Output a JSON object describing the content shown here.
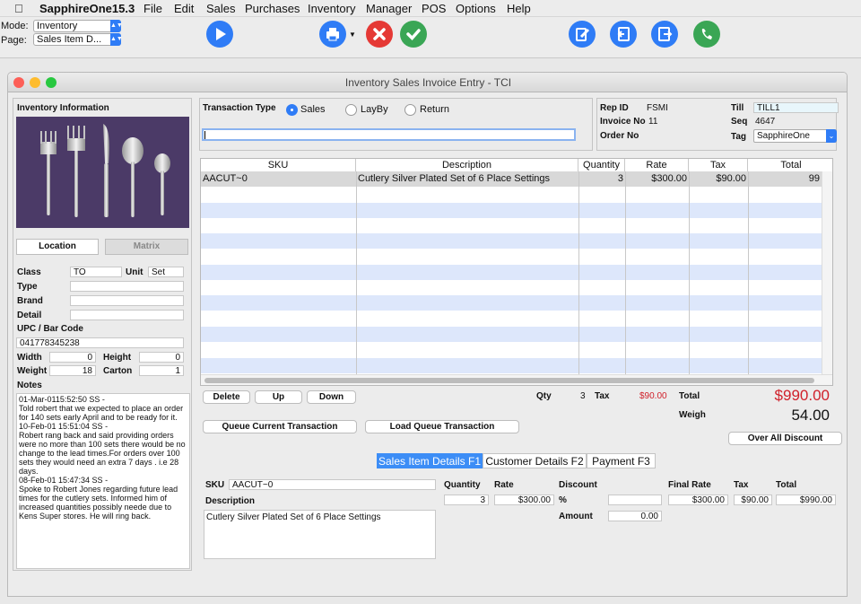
{
  "menubar": {
    "app_name": "SapphireOne15.3",
    "items": [
      "File",
      "Edit",
      "Sales",
      "Purchases",
      "Inventory",
      "Manager",
      "POS",
      "Options",
      "Help"
    ]
  },
  "toolbar": {
    "mode_label": "Mode:",
    "mode_value": "Inventory",
    "page_label": "Page:",
    "page_value": "Sales Item D..."
  },
  "window": {
    "title": "Inventory Sales Invoice Entry - TCI"
  },
  "inventory": {
    "heading": "Inventory Information",
    "tab_location": "Location",
    "tab_matrix": "Matrix",
    "class_label": "Class",
    "class_value": "TO",
    "unit_label": "Unit",
    "unit_value": "Set",
    "type_label": "Type",
    "brand_label": "Brand",
    "detail_label": "Detail",
    "upc_label": "UPC / Bar Code",
    "upc_value": "041778345238",
    "width_label": "Width",
    "width_value": "0",
    "height_label": "Height",
    "height_value": "0",
    "weight_label": "Weight",
    "weight_value": "18",
    "carton_label": "Carton",
    "carton_value": "1",
    "notes_label": "Notes",
    "notes_text": "01-Mar-0115:52:50 SS -\nTold robert that we expected to place an order for 140 sets early April and to be ready for it.\n10-Feb-01 15:51:04 SS -\nRobert rang back and said providing orders were no more than 100 sets there would be no change to the lead times.For orders over 100 sets they would need an extra 7 days . i.e 28 days.\n08-Feb-01 15:47:34 SS -\nSpoke to Robert Jones regarding future lead times for the cutlery sets. Informed him of increased quantities possibly neede due to Kens Super stores. He will ring back."
  },
  "transaction": {
    "label": "Transaction Type",
    "options": [
      "Sales",
      "LayBy",
      "Return"
    ],
    "selected": "Sales"
  },
  "header_info": {
    "rep_label": "Rep ID",
    "rep_value": "FSMI",
    "invoice_label": "Invoice No",
    "invoice_value": "11",
    "order_label": "Order No",
    "till_label": "Till",
    "till_value": "TILL1",
    "seq_label": "Seq",
    "seq_value": "4647",
    "tag_label": "Tag",
    "tag_value": "SapphireOne"
  },
  "grid": {
    "columns": [
      "SKU",
      "Description",
      "Quantity",
      "Rate",
      "Tax",
      "Total"
    ],
    "rows": [
      {
        "sku": "AACUT~0",
        "description": "Cutlery Silver Plated Set of 6 Place Settings",
        "quantity": "3",
        "rate": "$300.00",
        "tax": "$90.00",
        "total": "99"
      }
    ]
  },
  "actions": {
    "delete": "Delete",
    "up": "Up",
    "down": "Down",
    "queue_current": "Queue Current Transaction",
    "load_queue": "Load Queue Transaction",
    "over_all_discount": "Over All Discount"
  },
  "totals": {
    "qty_label": "Qty",
    "qty_value": "3",
    "tax_label": "Tax",
    "tax_value": "$90.00",
    "total_label": "Total",
    "total_value": "$990.00",
    "weigh_label": "Weigh",
    "weigh_value": "54.00"
  },
  "tabs": [
    "Sales Item Details F1",
    "Customer Details F2",
    "Payment F3"
  ],
  "details": {
    "sku_label": "SKU",
    "sku_value": "AACUT~0",
    "description_label": "Description",
    "description_value": "Cutlery Silver Plated Set of 6 Place Settings",
    "quantity_label": "Quantity",
    "quantity_value": "3",
    "rate_label": "Rate",
    "rate_value": "$300.00",
    "discount_label": "Discount",
    "percent_label": "%",
    "amount_label": "Amount",
    "amount_value": "0.00",
    "final_rate_label": "Final Rate",
    "final_rate_value": "$300.00",
    "tax_label": "Tax",
    "tax_value": "$90.00",
    "total_label": "Total",
    "total_value": "$990.00"
  },
  "colors": {
    "accent": "#2f7cf6",
    "total_red": "#d0202a",
    "row_stripe": "#dde7fb"
  }
}
